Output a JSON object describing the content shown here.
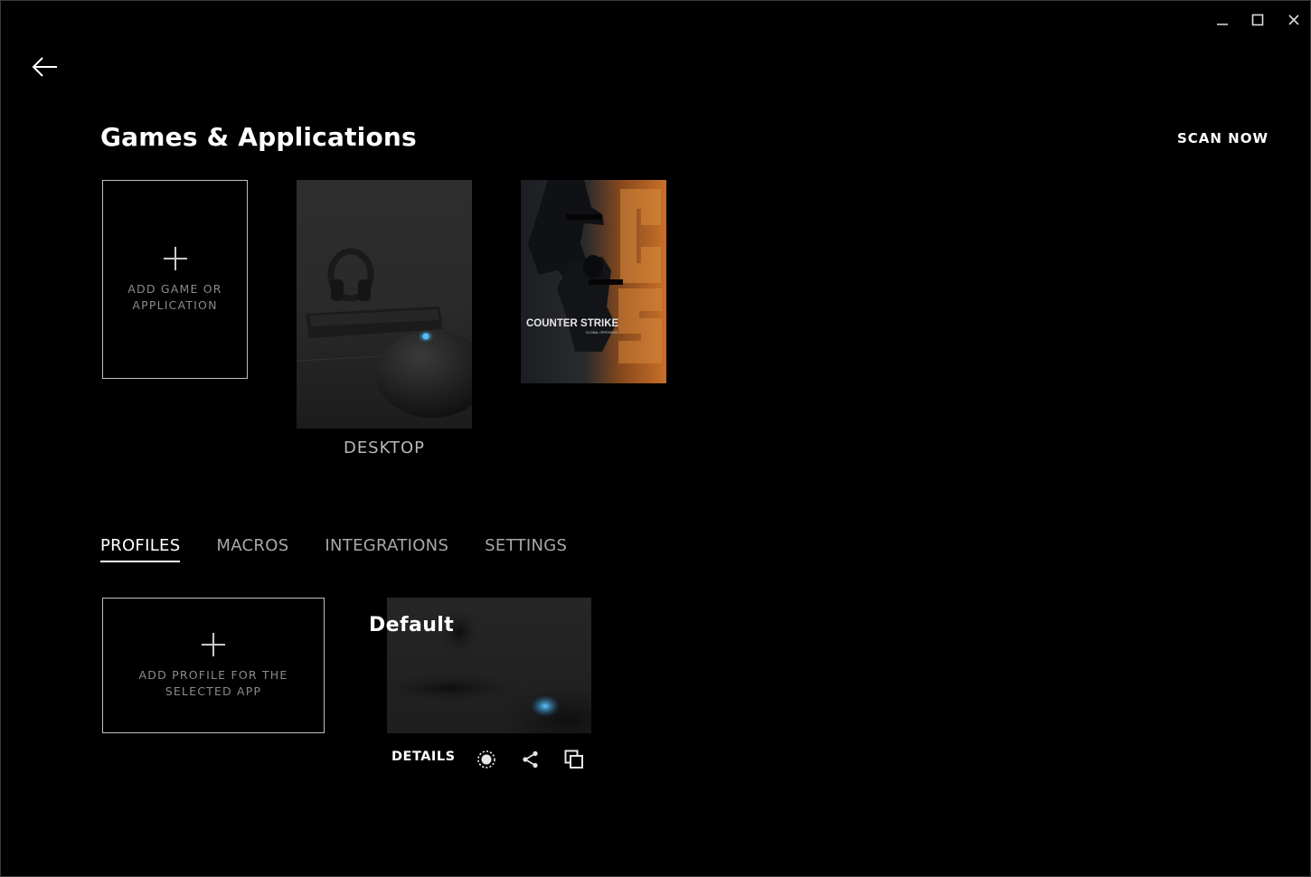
{
  "window": {
    "controls": [
      "minimize-icon",
      "maximize-icon",
      "close-icon"
    ]
  },
  "nav": {
    "back_icon": "arrow-left-icon"
  },
  "header": {
    "title": "Games & Applications",
    "scan_label": "SCAN NOW"
  },
  "games": {
    "add_label": "ADD GAME OR APPLICATION",
    "items": [
      {
        "name": "DESKTOP",
        "image": "desktop-mouse-keyboard"
      },
      {
        "name": "Counter-Strike: Global Offensive",
        "image": "csgo-cover",
        "cover_text": "COUNTER STRIKE",
        "cover_sub": "GLOBAL OFFENSIVE"
      }
    ]
  },
  "tabs": [
    {
      "label": "PROFILES",
      "active": true
    },
    {
      "label": "MACROS",
      "active": false
    },
    {
      "label": "INTEGRATIONS",
      "active": false
    },
    {
      "label": "SETTINGS",
      "active": false
    }
  ],
  "profiles": {
    "add_label": "ADD PROFILE FOR THE SELECTED APP",
    "items": [
      {
        "name": "Default",
        "details_label": "DETAILS",
        "actions": [
          "active-profile-icon",
          "share-icon",
          "duplicate-icon"
        ]
      }
    ]
  },
  "colors": {
    "background": "#000000",
    "accent_blue": "#3fb4ff",
    "csgo_orange": "#c8702a"
  }
}
